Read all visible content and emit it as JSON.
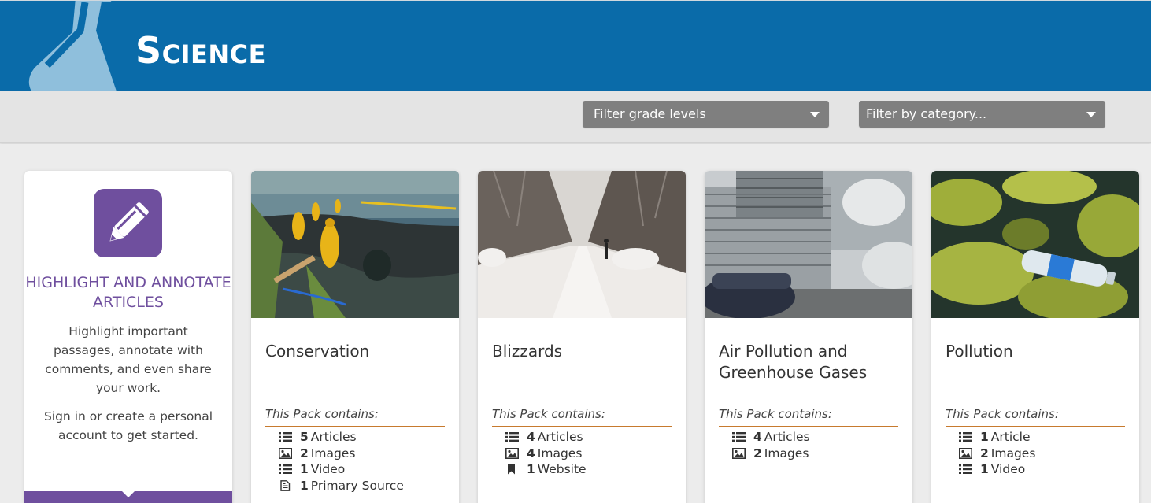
{
  "header": {
    "title": "Science"
  },
  "filters": {
    "grade": "Filter grade levels",
    "category": "Filter by category..."
  },
  "promo": {
    "title": "Highlight and annotate articles",
    "text": "Highlight important passages, annotate with comments, and even share your work.",
    "text2": "Sign in or create a personal account to get started."
  },
  "cards": [
    {
      "title": "Conservation",
      "contains_label": "This Pack contains:",
      "items": [
        {
          "icon": "list-icon",
          "count": "5",
          "label": "Articles"
        },
        {
          "icon": "image-icon",
          "count": "2",
          "label": "Images"
        },
        {
          "icon": "list-icon",
          "count": "1",
          "label": "Video"
        },
        {
          "icon": "document-icon",
          "count": "1",
          "label": "Primary Source"
        }
      ]
    },
    {
      "title": "Blizzards",
      "contains_label": "This Pack contains:",
      "items": [
        {
          "icon": "list-icon",
          "count": "4",
          "label": "Articles"
        },
        {
          "icon": "image-icon",
          "count": "4",
          "label": "Images"
        },
        {
          "icon": "bookmark-icon",
          "count": "1",
          "label": "Website"
        }
      ]
    },
    {
      "title": "Air Pollution and Greenhouse Gases",
      "contains_label": "This Pack contains:",
      "items": [
        {
          "icon": "list-icon",
          "count": "4",
          "label": "Articles"
        },
        {
          "icon": "image-icon",
          "count": "2",
          "label": "Images"
        }
      ]
    },
    {
      "title": "Pollution",
      "contains_label": "This Pack contains:",
      "items": [
        {
          "icon": "list-icon",
          "count": "1",
          "label": "Article"
        },
        {
          "icon": "image-icon",
          "count": "2",
          "label": "Images"
        },
        {
          "icon": "list-icon",
          "count": "1",
          "label": "Video"
        }
      ]
    }
  ]
}
